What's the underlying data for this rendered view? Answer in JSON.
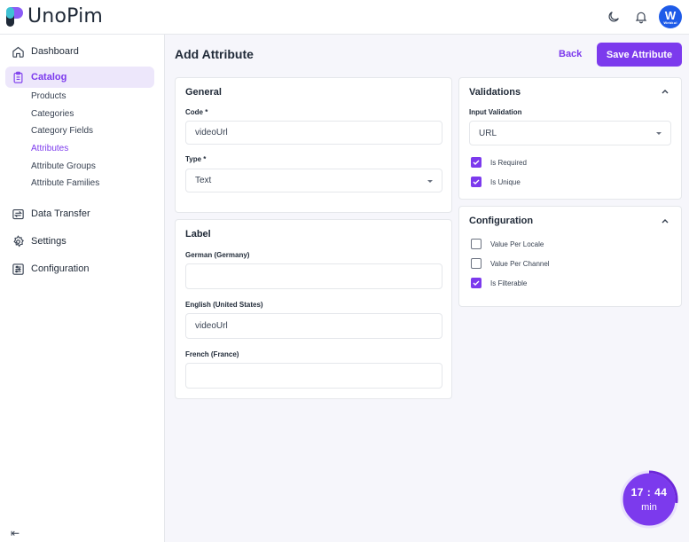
{
  "header": {
    "logo_text": "UnoPim",
    "avatar_letter": "W",
    "avatar_sub": "Webkul"
  },
  "sidebar": {
    "items": [
      {
        "label": "Dashboard",
        "icon": "home-icon"
      },
      {
        "label": "Catalog",
        "icon": "clipboard-icon",
        "active": true
      },
      {
        "label": "Data Transfer",
        "icon": "transfer-icon"
      },
      {
        "label": "Settings",
        "icon": "gear-icon"
      },
      {
        "label": "Configuration",
        "icon": "sliders-icon"
      }
    ],
    "catalog_sub": [
      "Products",
      "Categories",
      "Category Fields",
      "Attributes",
      "Attribute Groups",
      "Attribute Families"
    ],
    "collapse_icon": "⇤"
  },
  "page": {
    "title": "Add Attribute",
    "back_label": "Back",
    "save_label": "Save Attribute"
  },
  "general": {
    "title": "General",
    "code_label": "Code *",
    "code_value": "videoUrl",
    "type_label": "Type *",
    "type_value": "Text"
  },
  "label_card": {
    "title": "Label",
    "fields": [
      {
        "label": "German (Germany)",
        "value": ""
      },
      {
        "label": "English (United States)",
        "value": "videoUrl"
      },
      {
        "label": "French (France)",
        "value": ""
      }
    ]
  },
  "validations": {
    "title": "Validations",
    "input_validation_label": "Input Validation",
    "input_validation_value": "URL",
    "checks": [
      {
        "label": "Is Required",
        "checked": true
      },
      {
        "label": "Is Unique",
        "checked": true
      }
    ]
  },
  "configuration": {
    "title": "Configuration",
    "checks": [
      {
        "label": "Value Per Locale",
        "checked": false
      },
      {
        "label": "Value Per Channel",
        "checked": false
      },
      {
        "label": "Is Filterable",
        "checked": true
      }
    ]
  },
  "timer": {
    "time": "17 : 44",
    "unit": "min",
    "progress": 0.27
  },
  "colors": {
    "accent": "#7c3aed",
    "avatar": "#1e5be8"
  }
}
